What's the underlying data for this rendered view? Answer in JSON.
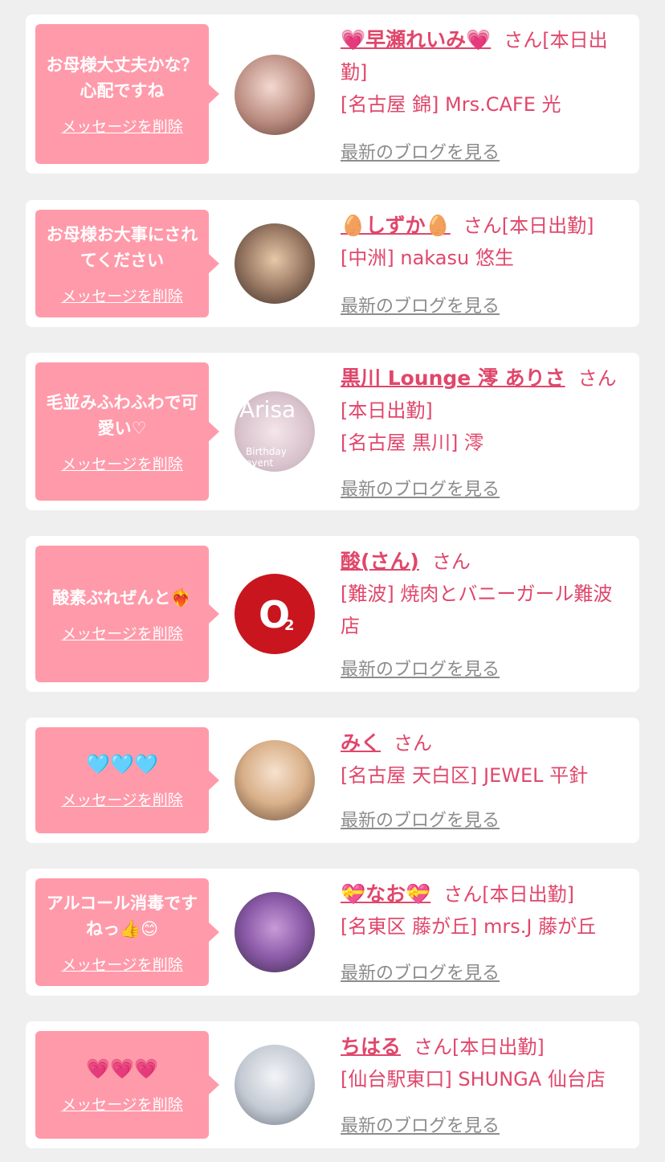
{
  "delete_label": "メッセージを削除",
  "blog_label": "最新のブログを見る",
  "san": "さん",
  "cards": [
    {
      "message": "お母様大丈夫かな？心配ですね",
      "name": "💗早瀬れいみ💗",
      "attendance": "[本日出勤]",
      "area": "[名古屋 錦]",
      "shop": "Mrs.CAFE 光"
    },
    {
      "message": "お母様お大事にされてください",
      "name": "🥚しずか🥚",
      "attendance": "[本日出勤]",
      "area": "[中洲]",
      "shop": "nakasu 悠生"
    },
    {
      "message": "毛並みふわふわで可愛い♡",
      "name": "黒川 Lounge 澪 ありさ",
      "attendance": "[本日出勤]",
      "area": "[名古屋 黒川]",
      "shop": "澪",
      "avatar_text": "Arisa",
      "avatar_sub": "Birthday event"
    },
    {
      "message": "酸素ぶれぜんと❤️‍🔥",
      "name": "酸(さん)",
      "attendance": "",
      "area": "[難波]",
      "shop": "焼肉とバニーガール難波店",
      "avatar_text": "O",
      "avatar_sub": "2"
    },
    {
      "message": "🩵🩵🩵",
      "name": "みく",
      "attendance": "",
      "area": "[名古屋 天白区]",
      "shop": "JEWEL 平針"
    },
    {
      "message": "アルコール消毒ですねっ👍😊",
      "name": "💝なお💝",
      "attendance": "[本日出勤]",
      "area": "[名東区 藤が丘]",
      "shop": "mrs.J 藤が丘"
    },
    {
      "message": "💗💗💗",
      "name": "ちはる",
      "attendance": "[本日出勤]",
      "area": "[仙台駅東口]",
      "shop": "SHUNGA 仙台店"
    }
  ]
}
